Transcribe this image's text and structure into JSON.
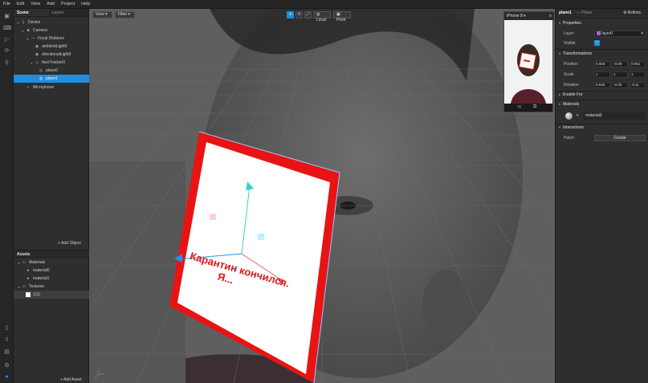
{
  "menu": [
    "File",
    "Edit",
    "View",
    "Add",
    "Project",
    "Help"
  ],
  "scene_panel": {
    "tab_scene": "Scene",
    "tab_layers": "Layers",
    "tree": [
      {
        "label": "Device",
        "depth": 0
      },
      {
        "label": "Camera",
        "depth": 1
      },
      {
        "label": "Focal Distance",
        "depth": 2
      },
      {
        "label": "ambientLight0",
        "depth": 3
      },
      {
        "label": "directionalLight0",
        "depth": 3
      },
      {
        "label": "faceTracker0",
        "depth": 3
      },
      {
        "label": "plane0",
        "depth": 4
      },
      {
        "label": "plane1",
        "depth": 4,
        "selected": true
      },
      {
        "label": "Microphone",
        "depth": 1
      }
    ],
    "add_object": "+ Add Object"
  },
  "assets_panel": {
    "title": "Assets",
    "items": [
      {
        "label": "Materials",
        "depth": 0
      },
      {
        "label": "material0",
        "depth": 1
      },
      {
        "label": "material1",
        "depth": 1
      },
      {
        "label": "Textures",
        "depth": 0
      },
      {
        "label": "1(1)",
        "depth": 1
      }
    ],
    "add_asset": "+ Add Asset"
  },
  "viewport": {
    "view_btn": "View",
    "filter_btn": "Filter",
    "local_btn": "Local",
    "pivot_btn": "Pivot",
    "plane_text_line1": "Карантин кончился.",
    "plane_text_line2": "Я..."
  },
  "preview": {
    "device": "iPhone 8"
  },
  "inspector": {
    "object_name": "plane1",
    "object_type": "— Plane",
    "actions": "Actions",
    "properties": "Properties",
    "layer_label": "Layer",
    "layer_value": "layer0",
    "visible_label": "Visible",
    "transformations": "Transformations",
    "position_label": "Position",
    "position": [
      "0.000",
      "-0.09",
      "0.061"
    ],
    "scale_label": "Scale",
    "scale": [
      "1",
      "1",
      "1"
    ],
    "rotation_label": "Rotation",
    "rotation": [
      "0.633",
      "-0.06",
      "-0.11"
    ],
    "enable_for": "Enable For",
    "materials": "Materials",
    "material_value": "material0",
    "interactions": "Interactions",
    "patch_label": "Patch",
    "create_btn": "Create"
  },
  "colors": {
    "accent": "#1e8fe0",
    "plane_border": "#e81414",
    "text_red": "#d91a1a"
  }
}
